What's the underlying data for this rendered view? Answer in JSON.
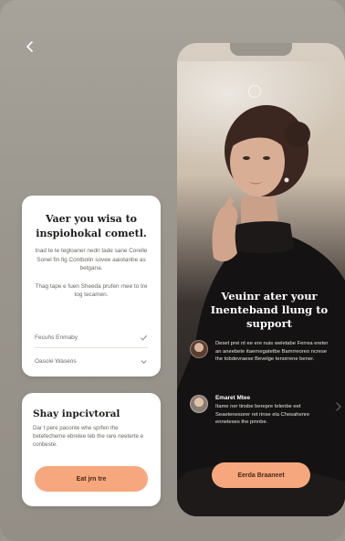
{
  "nav": {
    "back_icon": "chevron-left-icon"
  },
  "card1": {
    "title": "Vaer you wisa to inspiohokal cometl.",
    "body1": "Inad te te tegloaner nedn tade sane Corelle Sonel fin fig Contbolin sovee aaiotanbe as betgana.",
    "body2": "Thag tape e fuen Sheeda prufen rnee to tre tog tecamen.",
    "options": [
      {
        "label": "Fecuhs Enmaby",
        "icon": "check-icon"
      },
      {
        "label": "Oasole Wasens",
        "icon": "chevron-down-icon"
      }
    ]
  },
  "card2": {
    "title": "Shay inpcivtoral",
    "body": "Dar t pere paconte whe sprfen the betefecheme ebrelee teb the rare neeterte e conbeste.",
    "button": "Eat jrn tre"
  },
  "phone": {
    "heading": "Veuinr ater your Inenteband llung to support",
    "testimonials": [
      {
        "name": "",
        "text": "Deset prei nt ee ere nuis weletabe Ferrea ereter an aneebete itaernegatetbe Bamrreoreo ncrese the tobdevraese Bevelge tenorrene bener."
      },
      {
        "name": "Emaret Mtee",
        "text": "Itame ner tinsbe berepre telenbe eet Seaetenesorer ret rinse ela Chesahenre enneteses the pmnbe."
      }
    ],
    "button": "Eerda Braaneet"
  },
  "colors": {
    "background": "#9a958d",
    "card": "#ffffff",
    "accent": "#f6a77d",
    "phone_dark": "#151313"
  }
}
